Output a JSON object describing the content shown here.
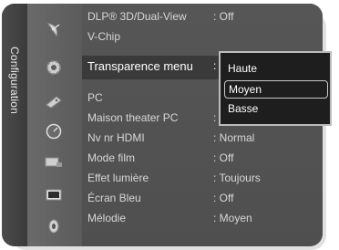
{
  "side_label": "Configuration",
  "menu": {
    "items": [
      {
        "label": "DLP® 3D/Dual-View",
        "value": ": Off"
      },
      {
        "label": "V-Chip",
        "value": ""
      },
      {
        "label": "Transparence menu",
        "value": ":"
      },
      {
        "label": "PC",
        "value": ""
      },
      {
        "label": "Maison theater PC",
        "value": ":"
      },
      {
        "label": "Nv nr HDMI",
        "value": ": Normal"
      },
      {
        "label": "Mode film",
        "value": ": Off"
      },
      {
        "label": "Effet lumière",
        "value": ": Toujours"
      },
      {
        "label": "Écran Bleu",
        "value": ": Off"
      },
      {
        "label": "Mélodie",
        "value": ": Moyen"
      }
    ]
  },
  "dropdown": {
    "options": [
      "Haute",
      "Moyen",
      "Basse"
    ],
    "selected": "Moyen"
  },
  "icons": [
    "satellite-dish-icon",
    "gear-icon",
    "remote-control-icon",
    "clock-icon",
    "input-source-icon",
    "picture-icon",
    "sound-icon"
  ]
}
